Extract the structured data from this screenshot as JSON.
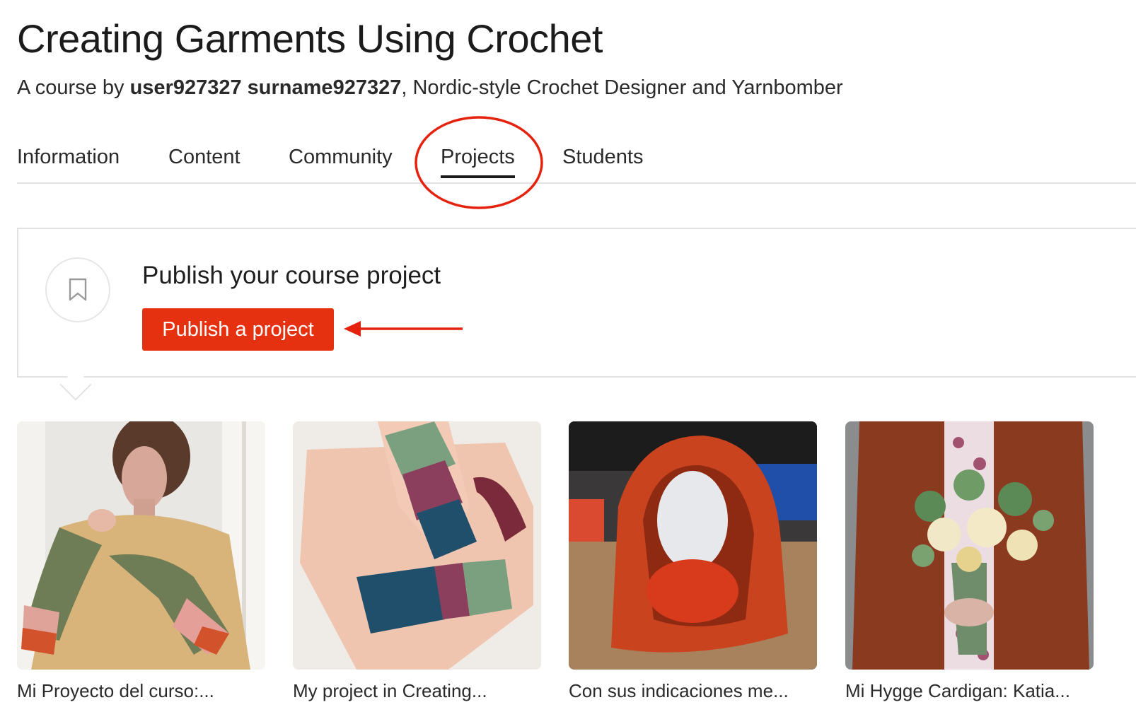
{
  "course": {
    "title": "Creating Garments Using Crochet",
    "byline_prefix": "A course by ",
    "author": "user927327 surname927327",
    "author_role": ", Nordic-style Crochet Designer and Yarnbomber"
  },
  "tabs": [
    {
      "label": "Information"
    },
    {
      "label": "Content"
    },
    {
      "label": "Community"
    },
    {
      "label": "Projects",
      "active": true
    },
    {
      "label": "Students"
    }
  ],
  "publish_card": {
    "heading": "Publish your course project",
    "button_label": "Publish a project",
    "icon": "bookmark-icon"
  },
  "projects": [
    {
      "caption": "Mi Proyecto del curso:..."
    },
    {
      "caption": "My project in Creating..."
    },
    {
      "caption": "Con sus indicaciones me..."
    },
    {
      "caption": "Mi Hygge Cardigan: Katia..."
    }
  ],
  "colors": {
    "accent": "#e5310f",
    "annotation": "#e5220e",
    "text": "#1f1f1f",
    "divider": "#e2e2e2"
  }
}
